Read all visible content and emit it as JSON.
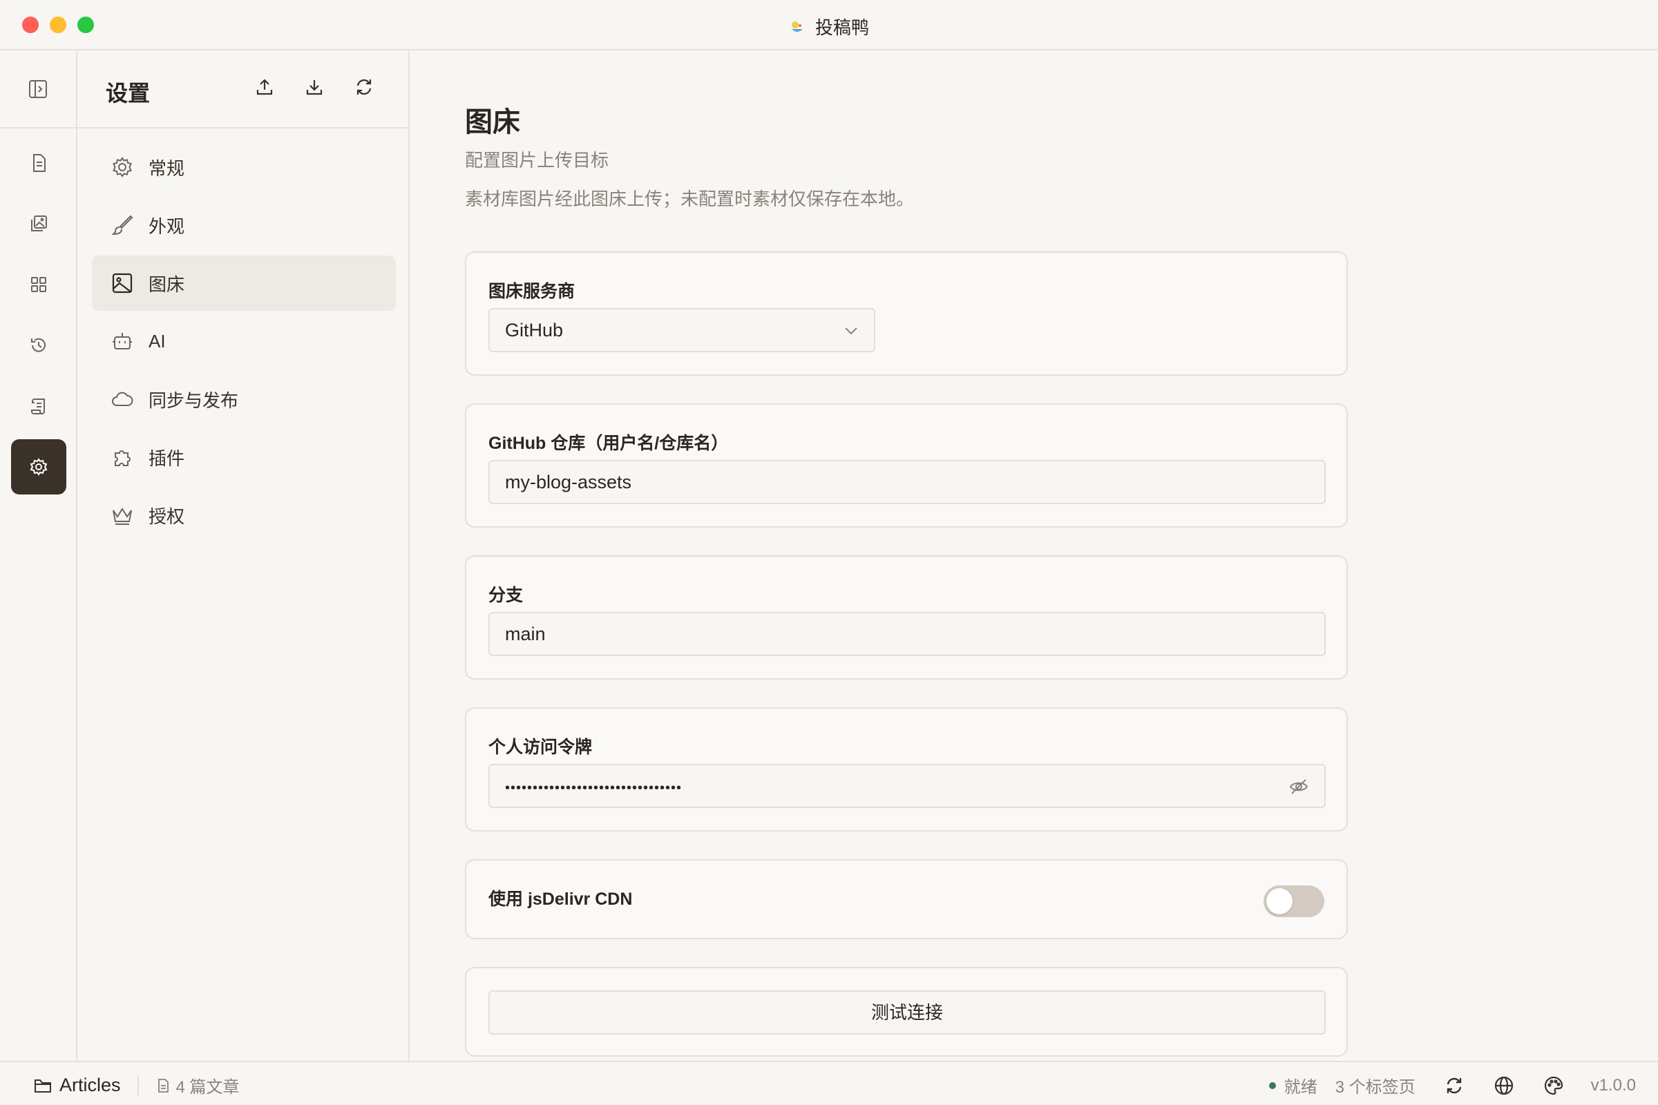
{
  "window": {
    "title": "投稿鸭"
  },
  "sidebar": {
    "title": "设置",
    "items": [
      {
        "label": "常规",
        "icon": "gear-icon"
      },
      {
        "label": "外观",
        "icon": "brush-icon"
      },
      {
        "label": "图床",
        "icon": "image-icon",
        "active": true
      },
      {
        "label": "AI",
        "icon": "robot-icon"
      },
      {
        "label": "同步与发布",
        "icon": "cloud-icon"
      },
      {
        "label": "插件",
        "icon": "puzzle-icon"
      },
      {
        "label": "授权",
        "icon": "crown-icon"
      }
    ]
  },
  "page": {
    "title": "图床",
    "subtitle": "配置图片上传目标",
    "description": "素材库图片经此图床上传；未配置时素材仅保存在本地。"
  },
  "form": {
    "provider": {
      "label": "图床服务商",
      "value": "GitHub"
    },
    "repo": {
      "label": "GitHub 仓库（用户名/仓库名）",
      "value": "my-blog-assets"
    },
    "branch": {
      "label": "分支",
      "value": "main"
    },
    "token": {
      "label": "个人访问令牌",
      "value": "••••••••••••••••••••••••••••••••"
    },
    "cdn": {
      "label": "使用 jsDelivr CDN",
      "enabled": false
    },
    "test_button": "测试连接"
  },
  "statusbar": {
    "workspace": "Articles",
    "article_count": "4 篇文章",
    "status": "就绪",
    "tabs_count": "3 个标签页",
    "version": "v1.0.0",
    "status_color": "#3b7a57"
  }
}
